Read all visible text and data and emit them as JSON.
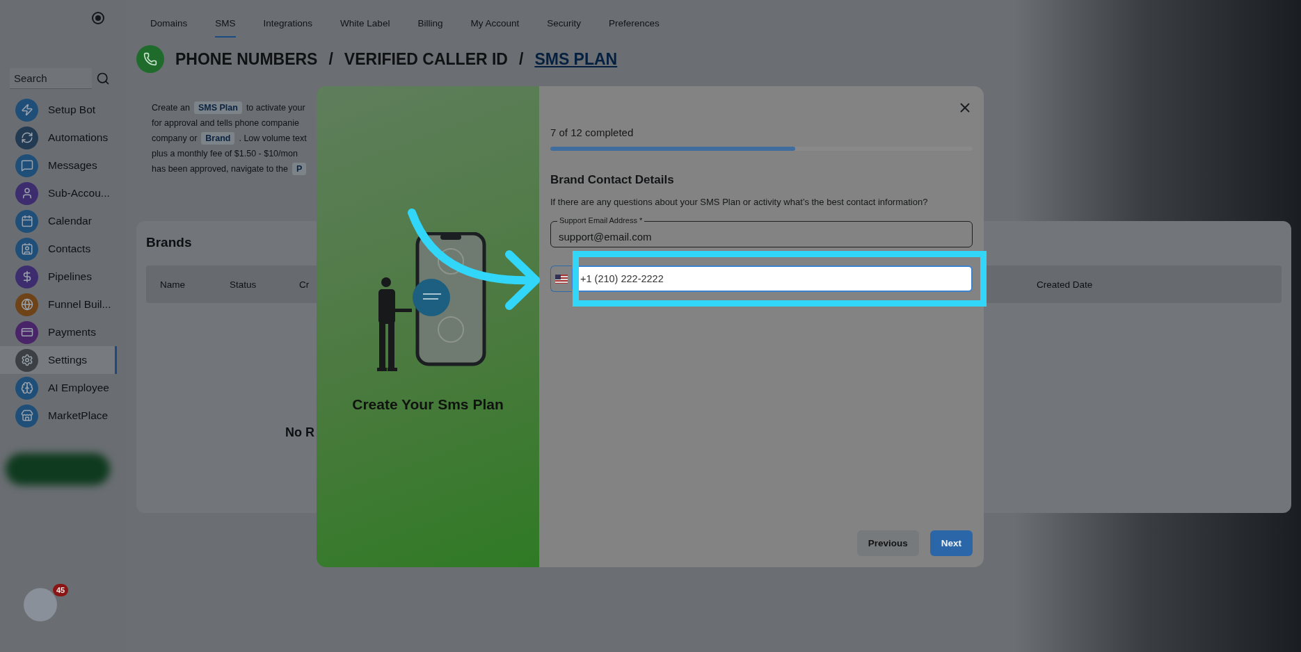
{
  "sidebar": {
    "search": {
      "placeholder": "Search"
    },
    "items": [
      {
        "label": "Setup Bot",
        "selected": false,
        "color": "#1f4f78"
      },
      {
        "label": "Automations",
        "selected": false,
        "color": "#223a52"
      },
      {
        "label": "Messages",
        "selected": false,
        "color": "#1f4f78"
      },
      {
        "label": "Sub-Accou...",
        "selected": false,
        "color": "#3d2c6e"
      },
      {
        "label": "Calendar",
        "selected": false,
        "color": "#1f4f78"
      },
      {
        "label": "Contacts",
        "selected": false,
        "color": "#1f4f78"
      },
      {
        "label": "Pipelines",
        "selected": false,
        "color": "#3d2c6e"
      },
      {
        "label": "Funnel Buil...",
        "selected": false,
        "color": "#6e4318"
      },
      {
        "label": "Payments",
        "selected": false,
        "color": "#4a2468"
      },
      {
        "label": "Settings",
        "selected": true,
        "color": "#3c4044"
      },
      {
        "label": "AI Employee",
        "selected": false,
        "color": "#1f4f78"
      },
      {
        "label": "MarketPlace",
        "selected": false,
        "color": "#1f4f78"
      }
    ],
    "notifications": "45"
  },
  "tabs": [
    {
      "label": "Domains",
      "selected": false
    },
    {
      "label": "SMS",
      "selected": true
    },
    {
      "label": "Integrations",
      "selected": false
    },
    {
      "label": "White Label",
      "selected": false
    },
    {
      "label": "Billing",
      "selected": false
    },
    {
      "label": "My Account",
      "selected": false
    },
    {
      "label": "Security",
      "selected": false
    },
    {
      "label": "Preferences",
      "selected": false
    }
  ],
  "breadcrumb": [
    {
      "label": "PHONE NUMBERS",
      "selected": false
    },
    {
      "label": "VERIFIED CALLER ID",
      "selected": false
    },
    {
      "label": "SMS PLAN",
      "selected": true
    }
  ],
  "breadcrumb_separator": "/",
  "description": [
    [
      {
        "text": "Create an",
        "chip": false
      },
      {
        "text": "SMS Plan",
        "chip": true
      },
      {
        "text": "to activate your",
        "chip": false
      }
    ],
    [
      {
        "text": "for approval and tells phone companie",
        "chip": false
      }
    ],
    [
      {
        "text": "company or",
        "chip": false
      },
      {
        "text": "Brand",
        "chip": true
      },
      {
        "text": ". Low volume text",
        "chip": false
      }
    ],
    [
      {
        "text": "plus a monthly fee of $1.50 - $10/mon",
        "chip": false
      }
    ],
    [
      {
        "text": "has been approved, navigate to the",
        "chip": false
      },
      {
        "text": "P",
        "chip": true
      }
    ]
  ],
  "brands": {
    "title": "Brands",
    "columns": [
      "Name",
      "Status",
      "Cr",
      "Created Date"
    ],
    "empty_text": "No R"
  },
  "modal": {
    "illustration_title": "Create Your Sms Plan",
    "progress": {
      "label": "7 of 12 completed",
      "level": 0.58
    },
    "section_title": "Brand Contact Details",
    "question": "If there are any questions about your SMS Plan or activity what’s the best contact information?",
    "email": {
      "label": "Support Email Address *",
      "value": "support@email.com"
    },
    "phone": {
      "value": "+1 (210) 222-2222",
      "highlighted": true
    },
    "buttons": [
      {
        "label": "Previous",
        "kind": "secondary"
      },
      {
        "label": "Next",
        "kind": "primary"
      }
    ]
  }
}
